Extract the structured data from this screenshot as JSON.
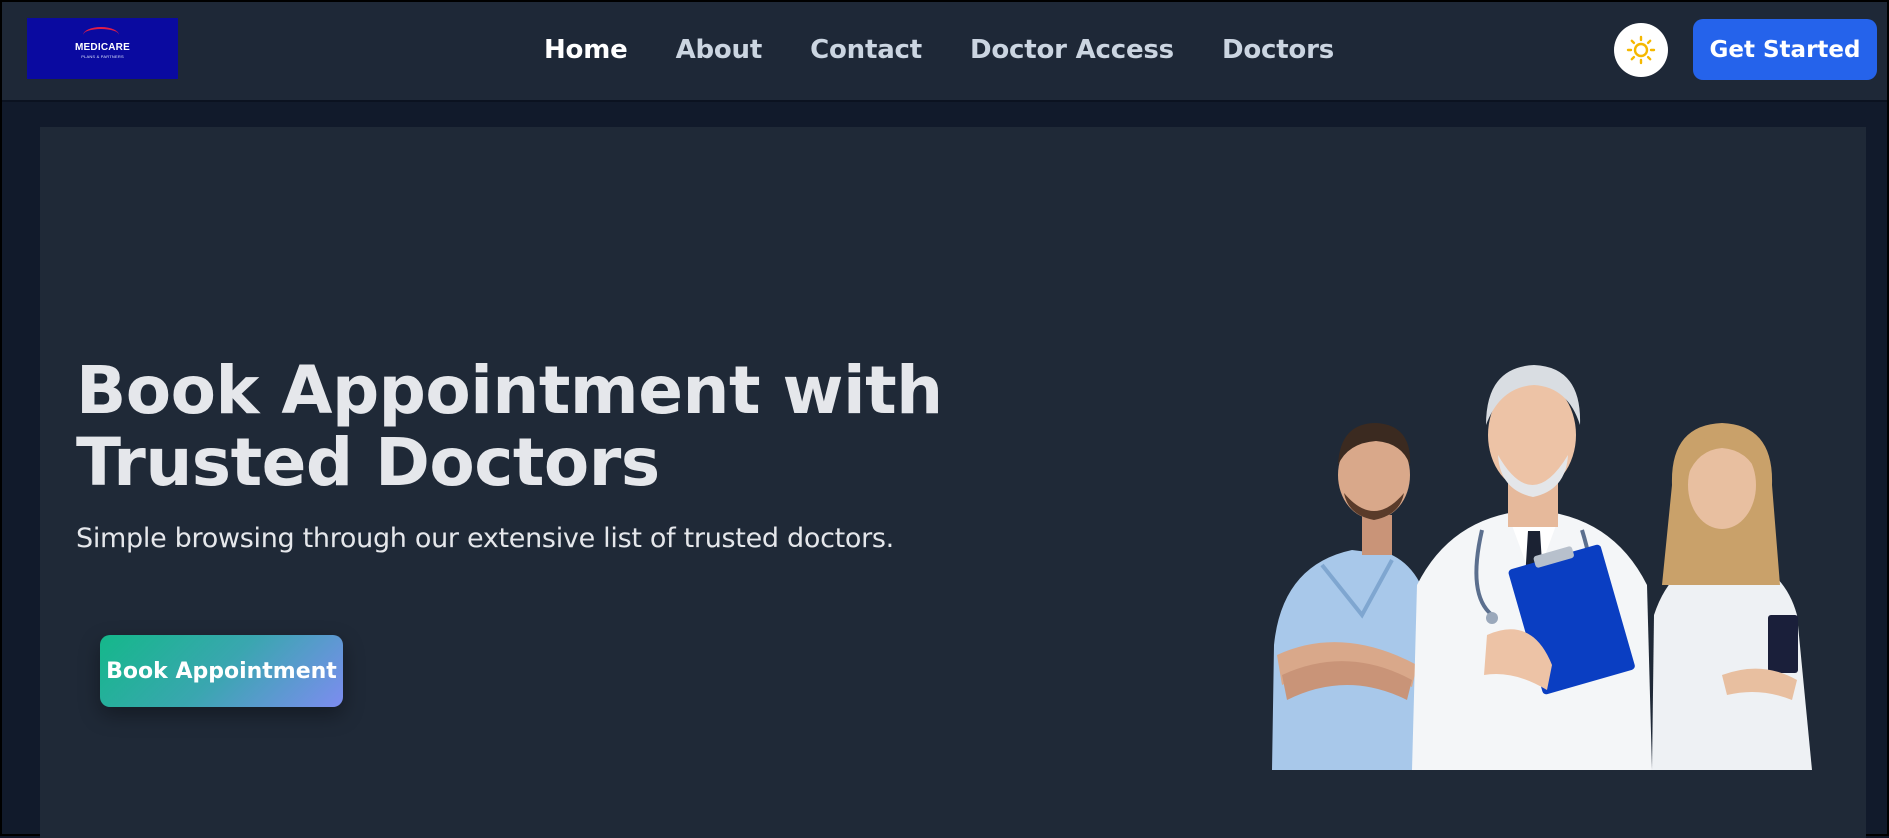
{
  "navbar": {
    "logo": {
      "name": "MEDICARE",
      "tagline": "PLANS & PARTNERS",
      "bg_color": "#0a0aa0"
    },
    "links": [
      {
        "label": "Home",
        "active": true
      },
      {
        "label": "About",
        "active": false
      },
      {
        "label": "Contact",
        "active": false
      },
      {
        "label": "Doctor Access",
        "active": false
      },
      {
        "label": "Doctors",
        "active": false
      }
    ],
    "theme_toggle_icon": "sun-icon",
    "cta_label": "Get Started",
    "cta_color": "#2563eb"
  },
  "hero": {
    "title_line1": "Book Appointment with",
    "title_line2": "Trusted Doctors",
    "subtitle": "Simple browsing through our extensive list of trusted doctors.",
    "button_label": "Book Appointment",
    "image_alt": "doctors-group-image"
  },
  "colors": {
    "page_bg": "#111a2b",
    "navbar_bg": "#1e2837",
    "hero_bg": "#1f2937",
    "accent_gradient": [
      "#14b88a",
      "#7d8cf0"
    ],
    "sun": "#f5b800"
  }
}
